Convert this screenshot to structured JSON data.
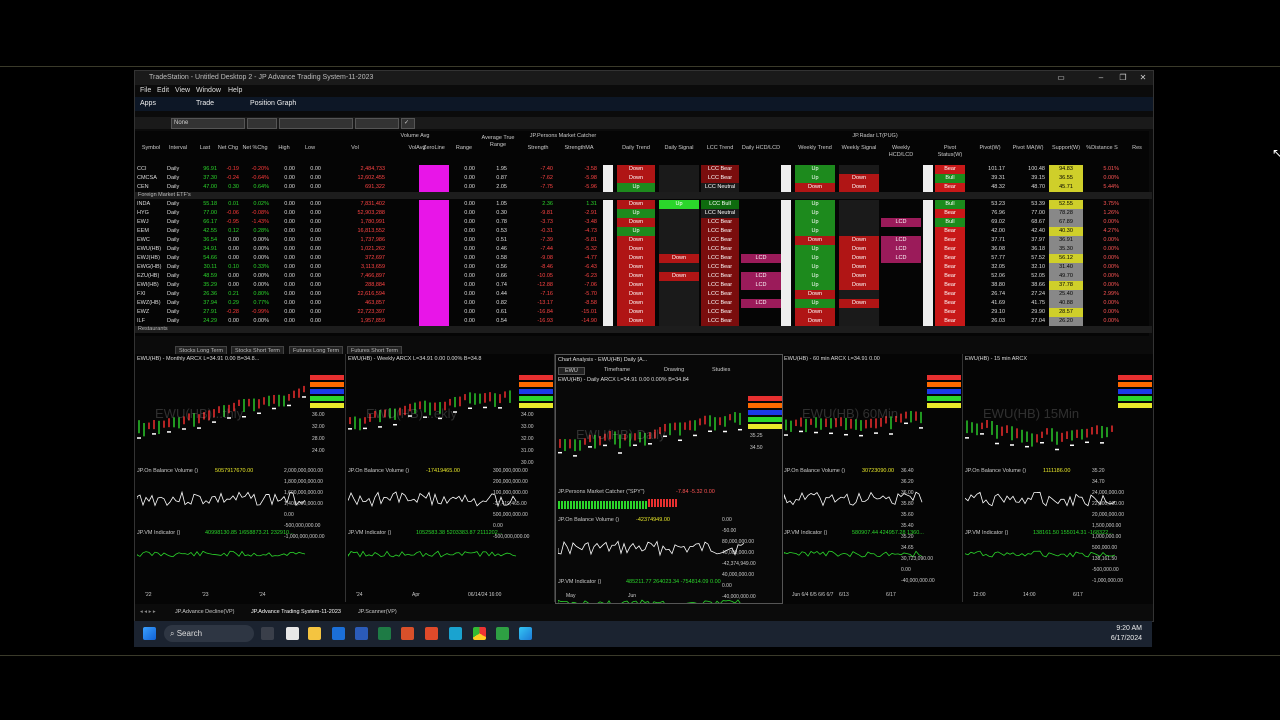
{
  "app": {
    "title": "TradeStation - Untitled Desktop 2 - JP Advance Trading System-11-2023",
    "menu": [
      "File",
      "Edit",
      "View",
      "Window",
      "Help"
    ],
    "shortcuts": [
      "Apps",
      "Trade",
      "Position Graph"
    ],
    "filter_none": "None"
  },
  "grid": {
    "group_headers": {
      "volume_avg": "Volume Avg",
      "average_true_range": "Average True Range",
      "jp_persons_market_catcher": "JP.Persons Market Catcher",
      "jp_radar": "JP.Radar LT(PUG)"
    },
    "columns": [
      "Symbol",
      "Interval",
      "Last",
      "Net Chg",
      "Net %Chg",
      "High",
      "Low",
      "Vol",
      "VolAvg",
      "ZeroLine",
      "Range",
      "",
      "Strength",
      "StrengthMA",
      "",
      "Daily Trend",
      "Daily Signal",
      "LCC Trend",
      "Daily HCD/LCD",
      "",
      "Weekly Trend",
      "Weekly Signal",
      "Weekly HCD/LCD",
      "",
      "Pivot Status(W)",
      "Pivot(W)",
      "Pivot MA(W)",
      "Support(W)",
      "%Distance S",
      "Res"
    ],
    "section_foreign": "Foreign Market ETF's",
    "section_restaurants": "Restaurants",
    "rows_top": [
      [
        "CCI",
        "Daily",
        "96.91",
        "-0.19",
        "-0.20%",
        "0.00",
        "0.00",
        "2,484,733",
        "2,484,733",
        "",
        "0.00",
        "1.95",
        "-7.40",
        "-3.58",
        "Down",
        "",
        "LCC Bear",
        "",
        "",
        "Up",
        "",
        "",
        "Bear",
        "101.17",
        "100.48",
        "94.83",
        "5.01%"
      ],
      [
        "CMCSA",
        "Daily",
        "37.30",
        "-0.24",
        "-0.64%",
        "0.00",
        "0.00",
        "12,602,455",
        "15,902,864",
        "",
        "0.00",
        "0.87",
        "-7.62",
        "-5.98",
        "Down",
        "",
        "LCC Bear",
        "",
        "",
        "Up",
        "Down",
        "",
        "Bull",
        "39.31",
        "39.15",
        "36.55",
        "0.00%"
      ],
      [
        "CEN",
        "Daily",
        "47.00",
        "0.30",
        "0.64%",
        "0.00",
        "0.00",
        "691,322",
        "2,418,818",
        "",
        "0.00",
        "2.05",
        "-7.75",
        "-5.96",
        "Up",
        "",
        "LCC Neutral",
        "",
        "",
        "Down",
        "Down",
        "",
        "Bear",
        "48.32",
        "48.70",
        "45.71",
        "5.44%"
      ]
    ],
    "rows_foreign": [
      [
        "INDA",
        "Daily",
        "55.18",
        "0.01",
        "0.02%",
        "0.00",
        "0.00",
        "7,831,402",
        "8,571,153",
        "",
        "0.00",
        "1.05",
        "2.36",
        "1.31",
        "Down",
        "Up",
        "LCC Bull",
        "",
        "",
        "Up",
        "",
        "",
        "Bull",
        "53.23",
        "53.39",
        "52.55",
        "3.75%"
      ],
      [
        "HYG",
        "Daily",
        "77.00",
        "-0.06",
        "-0.08%",
        "0.00",
        "0.00",
        "52,903,288",
        "35,620,905",
        "",
        "0.00",
        "0.30",
        "-9.81",
        "-2.91",
        "Up",
        "",
        "LCC Neutral",
        "",
        "",
        "Up",
        "",
        "",
        "Bear",
        "76.96",
        "77.00",
        "78.28",
        "1.26%"
      ],
      [
        "EWJ",
        "Daily",
        "66.17",
        "-0.95",
        "-1.43%",
        "0.00",
        "0.00",
        "1,780,991",
        "4,932,729",
        "",
        "0.00",
        "0.78",
        "-3.73",
        "-3.48",
        "Down",
        "",
        "LCC Bear",
        "",
        "",
        "Up",
        "",
        "LCD",
        "Bull",
        "69.02",
        "68.67",
        "67.89",
        "0.00%"
      ],
      [
        "EEM",
        "Daily",
        "42.55",
        "0.12",
        "0.28%",
        "0.00",
        "0.00",
        "16,813,552",
        "23,665,083",
        "",
        "0.00",
        "0.53",
        "-0.31",
        "-4.73",
        "Up",
        "",
        "LCC Bear",
        "",
        "",
        "Up",
        "",
        "",
        "Bear",
        "42.00",
        "42.40",
        "40.30",
        "4.27%"
      ],
      [
        "EWC",
        "Daily",
        "36.54",
        "0.00",
        "0.00%",
        "0.00",
        "0.00",
        "1,737,986",
        "1,951,919",
        "",
        "0.00",
        "0.51",
        "-7.39",
        "-5.81",
        "Down",
        "",
        "LCC Bear",
        "",
        "",
        "Down",
        "Down",
        "LCD",
        "Bear",
        "37.71",
        "37.97",
        "36.91",
        "0.00%"
      ],
      [
        "EWU(HB)",
        "Daily",
        "34.91",
        "0.00",
        "0.00%",
        "0.00",
        "0.00",
        "1,021,262",
        "1,046,473",
        "",
        "0.00",
        "0.46",
        "-7.44",
        "-5.32",
        "Down",
        "",
        "LCC Bear",
        "",
        "",
        "Up",
        "Down",
        "LCD",
        "Bear",
        "36.08",
        "36.18",
        "35.30",
        "0.00%"
      ],
      [
        "EWJ(HB)",
        "Daily",
        "54.66",
        "0.00",
        "0.00%",
        "0.00",
        "0.00",
        "372,697",
        "306,136",
        "",
        "0.00",
        "0.58",
        "-9.08",
        "-4.77",
        "Down",
        "Down",
        "LCC Bear",
        "LCD",
        "",
        "Up",
        "Down",
        "LCD",
        "Bear",
        "57.77",
        "57.52",
        "56.12",
        "0.00%"
      ],
      [
        "EWG(HB)",
        "Daily",
        "30.11",
        "0.10",
        "0.33%",
        "0.00",
        "0.00",
        "3,113,659",
        "1,251,600",
        "",
        "0.00",
        "0.56",
        "-8.46",
        "-6.43",
        "Down",
        "",
        "LCC Bear",
        "",
        "",
        "Up",
        "Down",
        "",
        "Bear",
        "32.05",
        "32.10",
        "31.40",
        "0.00%"
      ],
      [
        "EZU(HB)",
        "Daily",
        "48.59",
        "0.00",
        "0.00%",
        "0.00",
        "0.00",
        "7,466,897",
        "2,991,681",
        "",
        "0.00",
        "0.66",
        "-10.05",
        "-6.23",
        "Down",
        "Down",
        "LCC Bear",
        "LCD",
        "",
        "Up",
        "Down",
        "",
        "Bear",
        "52.06",
        "52.05",
        "49.70",
        "0.00%"
      ],
      [
        "EWI(HB)",
        "Daily",
        "35.29",
        "0.00",
        "0.00%",
        "0.00",
        "0.00",
        "288,884",
        "241,689",
        "",
        "0.00",
        "0.74",
        "-12.88",
        "-7.06",
        "Down",
        "",
        "LCC Bear",
        "LCD",
        "",
        "Up",
        "Down",
        "",
        "Bear",
        "38.80",
        "38.66",
        "37.78",
        "0.00%"
      ],
      [
        "FXI",
        "Daily",
        "26.36",
        "0.21",
        "0.80%",
        "0.00",
        "0.00",
        "22,616,594",
        "27,488,617",
        "",
        "0.00",
        "0.44",
        "-7.16",
        "-5.70",
        "Down",
        "",
        "LCC Bear",
        "",
        "",
        "Down",
        "",
        "",
        "Bear",
        "26.74",
        "27.24",
        "25.40",
        "2.99%"
      ],
      [
        "EWZ(HB)",
        "Daily",
        "37.94",
        "0.29",
        "0.77%",
        "0.00",
        "0.00",
        "463,857",
        "339,720",
        "",
        "0.00",
        "0.82",
        "-13.17",
        "-8.58",
        "Down",
        "",
        "LCC Bear",
        "LCD",
        "",
        "Up",
        "Down",
        "",
        "Bear",
        "41.69",
        "41.75",
        "40.88",
        "0.00%"
      ],
      [
        "EWZ",
        "Daily",
        "27.91",
        "-0.28",
        "-0.99%",
        "0.00",
        "0.00",
        "22,723,397",
        "29,076,844",
        "",
        "0.00",
        "0.61",
        "-16.84",
        "-15.01",
        "Down",
        "",
        "LCC Bear",
        "",
        "",
        "Down",
        "",
        "",
        "Bear",
        "29.10",
        "29.90",
        "28.57",
        "0.00%"
      ],
      [
        "ILF",
        "Daily",
        "24.29",
        "0.00",
        "0.00%",
        "0.00",
        "0.00",
        "1,957,859",
        "1,932,214",
        "",
        "0.00",
        "0.54",
        "-16.93",
        "-14.90",
        "Down",
        "",
        "LCC Bear",
        "",
        "",
        "Down",
        "",
        "",
        "Bear",
        "26.03",
        "27.04",
        "26.20",
        "0.00%"
      ]
    ]
  },
  "view_tabs": [
    "Stocks Long Term",
    "Stocks Short Term",
    "Futures Long Term",
    "Futures Short Term"
  ],
  "charts": [
    {
      "title": "EWU(HB) - Monthly  ARCX   L=34.91  0.00  B=34.8...",
      "big": "EWU(HB)...thly",
      "obv": "JP.On Balance Volume ()",
      "obv_val": "5057917670.00",
      "vm": "JP.VM Indicator ()",
      "vm_val": "40998130.85  1/658873.21  232910...",
      "x1": "'22",
      "x2": "'23",
      "x3": "'24",
      "ax": [
        "2,000,000,000.00",
        "1,800,000,000.00",
        "1,600,000,000.00",
        "1,400,000,000.00",
        "0.00",
        "-500,000,000.00",
        "-1,000,000,000.00"
      ],
      "py": [
        "36.00",
        "32.00",
        "28.00",
        "24.00"
      ]
    },
    {
      "title": "EWU(HB) - Weekly  ARCX   L=34.91  0.00  0.00%  B=34.8",
      "big": "EWU(HB)...ekly",
      "obv": "JP.On Balance Volume ()",
      "obv_val": "-17419465.00",
      "vm": "JP.VM Indicator ()",
      "vm_val": "1052583.38  5203383.87  2111202...",
      "x1": "'24",
      "x2": "Apr",
      "x3": "06/14/24 16:00",
      "ax": [
        "300,000,000.00",
        "200,000,000.00",
        "100,000,000.00",
        "-17,419,465.00",
        "500,000,000.00",
        "0.00",
        "-500,000,000.00"
      ],
      "py": [
        "34.00",
        "33.00",
        "32.00",
        "31.00",
        "30.00"
      ]
    },
    {
      "title": "Chart Analysis - EWU(HB) Daily [A...",
      "sub": "EWU(HB) - Daily  ARCX   L=34.91  0.00  0.00%  B=34.84",
      "symbol": "EWU",
      "timeframe": "Timeframe",
      "drawing": "Drawing",
      "studies": "Studies",
      "big": "EWU(HB) Daily",
      "pmc": "JP.Persons Market Catcher (\"SPY\")",
      "pmc_val": "-7.84  -5.32  0.00",
      "obv": "JP.On Balance Volume ()",
      "obv_val": "-42374949.00",
      "vm": "JP.VM Indicator ()",
      "vm_val": "485211.77  264023.34  -754814.09  0.00",
      "x1": "May",
      "x2": "Jun",
      "ax": [
        "0.00",
        "-50.00",
        "80,000,000.00",
        "40,000,000.00",
        "-42,374,949.00",
        "40,000,000.00",
        "0.00",
        "-40,000,000.00"
      ],
      "py": [
        "35.25",
        "34.50"
      ]
    },
    {
      "title": "EWU(HB) - 60 min  ARCX   L=34.91  0.00",
      "big": "EWU(HB) 60Min",
      "obv": "JP.On Balance Volume ()",
      "obv_val": "30723090.00",
      "vm": "JP.VM Indicator ()",
      "vm_val": "580907.44  424957.28  1360...",
      "x1": "Jun 6/4  6/5  6/6  6/7",
      "x2": "6/13",
      "x3": "6/17",
      "ax": [
        "36.40",
        "36.20",
        "36.00",
        "35.80",
        "35.60",
        "35.40",
        "35.20",
        "34.65",
        "30,723,090.00",
        "0.00",
        "-40,000,000.00",
        "2,500,000.00",
        "580,907.44",
        "-1,500,000.00"
      ],
      "py": []
    },
    {
      "title": "EWU(HB) - 15 min  ARCX",
      "big": "EWU(HB) 15Min",
      "obv": "JP.On Balance Volume ()",
      "obv_val": "1111186.00",
      "vm": "JP.VM Indicator ()",
      "vm_val": "138161.50  155014.31  -168322...",
      "x1": "12:00",
      "x2": "14:00",
      "x3": "6/17",
      "ax": [
        "35.20",
        "34.70",
        "24,000,000.00",
        "22,000,000.00",
        "20,000,000.00",
        "1,500,000.00",
        "1,000,000.00",
        "500,000.00",
        "138,161.50",
        "-500,000.00",
        "-1,000,000.00"
      ],
      "py": []
    }
  ],
  "bottom_tabs": [
    "JP.Advance Decline(VP)",
    "JP.Advance Trading System-11-2023",
    "JP.Scanner(VP)"
  ],
  "taskbar": {
    "search": "Search",
    "time": "9:20 AM",
    "date": "6/17/2024"
  },
  "colors": {
    "down": "#b01515",
    "up": "#1d8a1d",
    "bear": "#c81818",
    "bull": "#1c8c1c",
    "magenta": "#e815e8",
    "lcd": "#9b1b5a",
    "bright_up": "#2bd62b"
  }
}
